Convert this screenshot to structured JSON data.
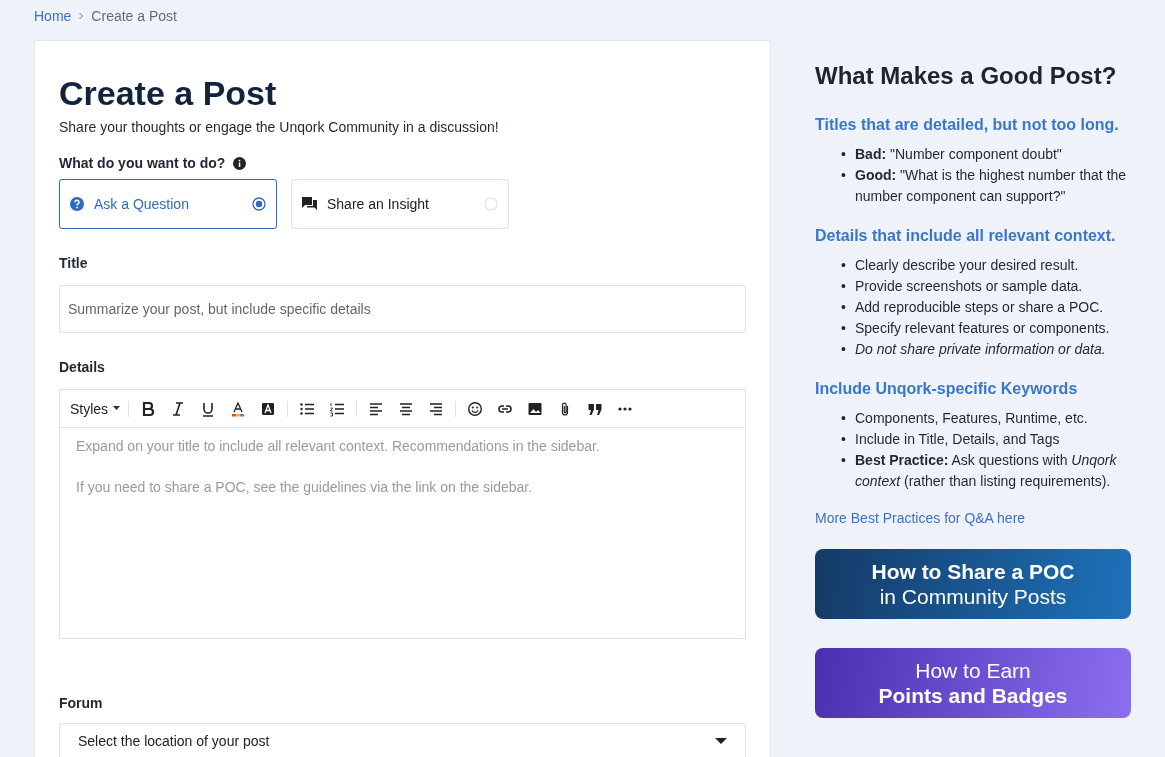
{
  "breadcrumb": [
    {
      "label": "Home",
      "kind": "link"
    },
    {
      "label": "Create a Post",
      "kind": "current"
    }
  ],
  "form": {
    "title": "Create a Post",
    "subtitle": "Share your thoughts or engage the Unqork Community in a discussion!",
    "action_label": "What do you want to do?",
    "actions": [
      {
        "label": "Ask a Question",
        "kind": "question",
        "selected": true
      },
      {
        "label": "Share an Insight",
        "kind": "insight",
        "selected": false
      }
    ],
    "title_field": {
      "label": "Title",
      "placeholder": "Summarize your post, but include specific details"
    },
    "details": {
      "label": "Details",
      "styles_label": "Styles",
      "placeholder_lines": [
        "Expand on your title to include all relevant context. Recommendations in the sidebar.",
        "If you need to share a POC, see the guidelines via the link on the sidebar."
      ]
    },
    "forum": {
      "label": "Forum",
      "placeholder": "Select the location of your post"
    }
  },
  "sidebar": {
    "heading": "What Makes a Good Post?",
    "sections": [
      {
        "heading": "Titles that are detailed, but not too long.",
        "bullet": "•",
        "items": [
          {
            "text": "**Bad:** \"Number component doubt\"",
            "italic": false
          },
          {
            "text": "**Good:** \"What is the highest number that the number component can support?\"",
            "italic": false
          }
        ]
      },
      {
        "heading": "Details that include all relevant context.",
        "bullet": "•",
        "items": [
          {
            "text": "Clearly describe your desired result.",
            "italic": false
          },
          {
            "text": "Provide screenshots or sample data.",
            "italic": false
          },
          {
            "text": "Add reproducible steps or share a POC.",
            "italic": false
          },
          {
            "text": "Specify relevant features or components.",
            "italic": false
          },
          {
            "text": "Do not share private information or data.",
            "italic": true
          }
        ]
      },
      {
        "heading": "Include Unqork-specific Keywords",
        "bullet": "•",
        "items": [
          {
            "text": "Components, Features, Runtime, etc.",
            "italic": false
          },
          {
            "text": "Include in Title, Details, and Tags",
            "italic": false
          },
          {
            "text": "**Best Practice:** Ask questions with *Unqork context* (rather than listing requirements).",
            "italic": false
          }
        ]
      }
    ],
    "link": "More Best Practices for Q&A here",
    "banners": [
      {
        "kind": "blue",
        "lines": [
          {
            "text": "How to Share a POC",
            "bold": true
          },
          {
            "text": "in Community Posts",
            "bold": false
          }
        ]
      },
      {
        "kind": "purple",
        "lines": [
          {
            "text": "How to Earn",
            "bold": false
          },
          {
            "text": "Points and Badges",
            "bold": true
          }
        ]
      }
    ]
  }
}
